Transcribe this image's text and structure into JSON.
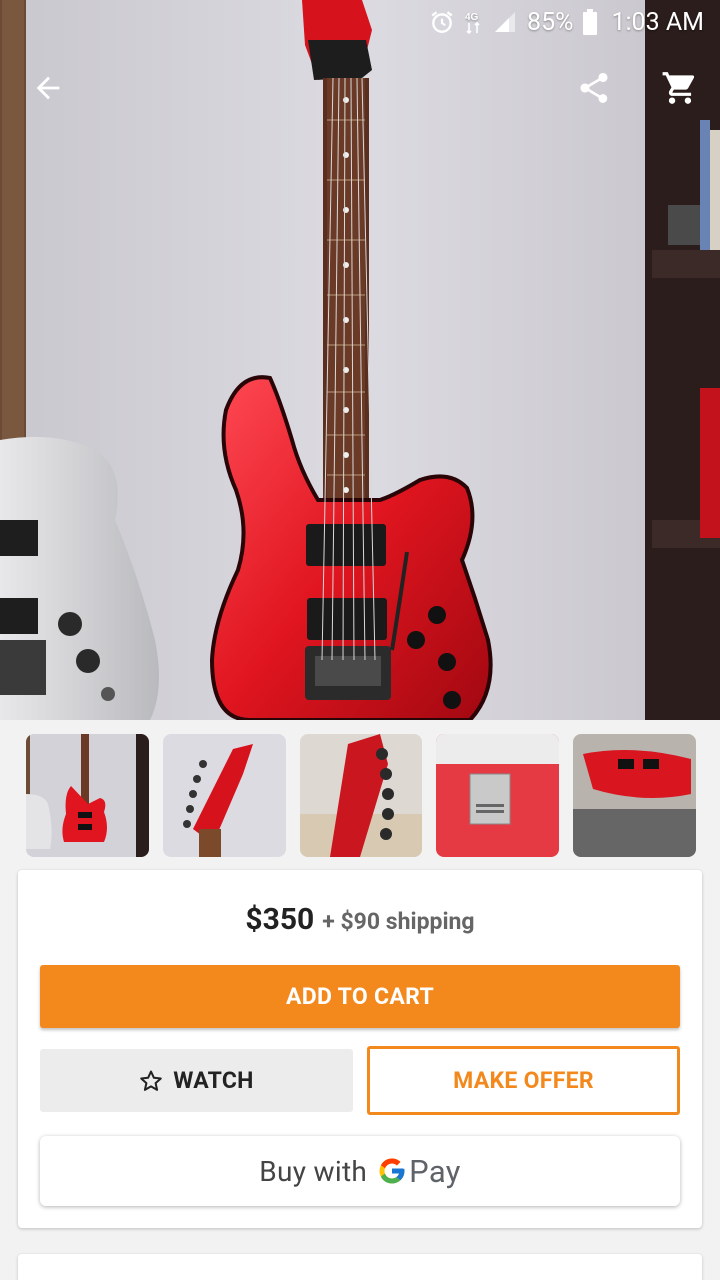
{
  "status_bar": {
    "battery": "85%",
    "time": "1:03 AM",
    "icons": [
      "alarm-icon",
      "data-4g-icon",
      "signal-icon",
      "battery-icon"
    ]
  },
  "top_bar": {
    "back_icon": "arrow-left-icon",
    "share_icon": "share-icon",
    "cart_icon": "cart-icon"
  },
  "gallery": {
    "main_photo": "red electric guitar hanging on wall",
    "thumbnails": [
      {
        "name": "thumbnail-1",
        "selected": true
      },
      {
        "name": "thumbnail-2",
        "selected": false
      },
      {
        "name": "thumbnail-3",
        "selected": false
      },
      {
        "name": "thumbnail-4",
        "selected": false
      },
      {
        "name": "thumbnail-5",
        "selected": false
      }
    ]
  },
  "listing": {
    "price": "$350",
    "shipping": "+ $90 shipping",
    "add_to_cart_label": "ADD TO CART",
    "watch_label": "WATCH",
    "make_offer_label": "MAKE OFFER",
    "gpay_prefix": "Buy with",
    "gpay_suffix": "Pay"
  },
  "colors": {
    "accent": "#f3891c",
    "guitar_red": "#e0151f"
  }
}
